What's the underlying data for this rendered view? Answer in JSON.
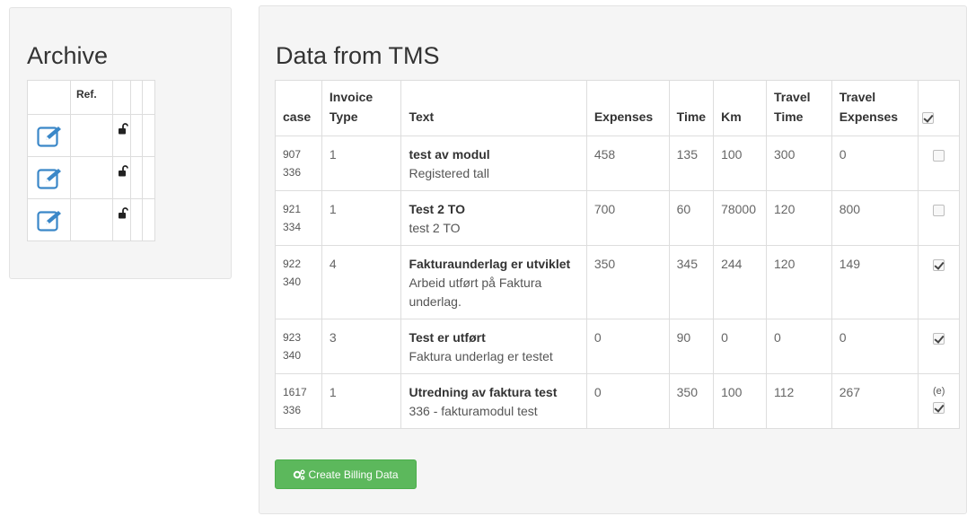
{
  "archive": {
    "title": "Archive",
    "column_header": "Ref.",
    "rows": [
      {
        "ref": ""
      },
      {
        "ref": ""
      },
      {
        "ref": ""
      }
    ]
  },
  "tms": {
    "title": "Data from TMS",
    "headers": {
      "case": "case",
      "invoice_type": "Invoice Type",
      "text": "Text",
      "expenses": "Expenses",
      "time": "Time",
      "km": "Km",
      "travel_time": "Travel Time",
      "travel_expenses": "Travel Expenses"
    },
    "select_all_checked": true,
    "rows": [
      {
        "case_id": "907",
        "case_sub": "336",
        "invoice_type": "1",
        "title": "test av modul",
        "description": "Registered tall",
        "expenses": "458",
        "time": "135",
        "km": "100",
        "travel_time": "300",
        "travel_expenses": "0",
        "flag": "",
        "checked": false
      },
      {
        "case_id": "921",
        "case_sub": "334",
        "invoice_type": "1",
        "title": "Test 2 TO",
        "description": "test 2 TO",
        "expenses": "700",
        "time": "60",
        "km": "78000",
        "travel_time": "120",
        "travel_expenses": "800",
        "flag": "",
        "checked": false
      },
      {
        "case_id": "922",
        "case_sub": "340",
        "invoice_type": "4",
        "title": "Fakturaunderlag er utviklet",
        "description": "Arbeid utført på Faktura underlag.",
        "expenses": "350",
        "time": "345",
        "km": "244",
        "travel_time": "120",
        "travel_expenses": "149",
        "flag": "",
        "checked": true
      },
      {
        "case_id": "923",
        "case_sub": "340",
        "invoice_type": "3",
        "title": "Test er utført",
        "description": "Faktura underlag er testet",
        "expenses": "0",
        "time": "90",
        "km": "0",
        "travel_time": "0",
        "travel_expenses": "0",
        "flag": "",
        "checked": true
      },
      {
        "case_id": "1617",
        "case_sub": "336",
        "invoice_type": "1",
        "title": "Utredning av faktura test",
        "description": "336 - fakturamodul test",
        "expenses": "0",
        "time": "350",
        "km": "100",
        "travel_time": "112",
        "travel_expenses": "267",
        "flag": "(e)",
        "checked": true
      }
    ],
    "create_button_label": "Create Billing Data"
  },
  "colors": {
    "panel_bg": "#f5f5f5",
    "border": "#dddddd",
    "success": "#5cb85c",
    "edit_icon": "#3a87c8"
  },
  "icons": {
    "edit": "edit-icon",
    "lock": "unlock-icon",
    "create": "cogs-icon"
  }
}
